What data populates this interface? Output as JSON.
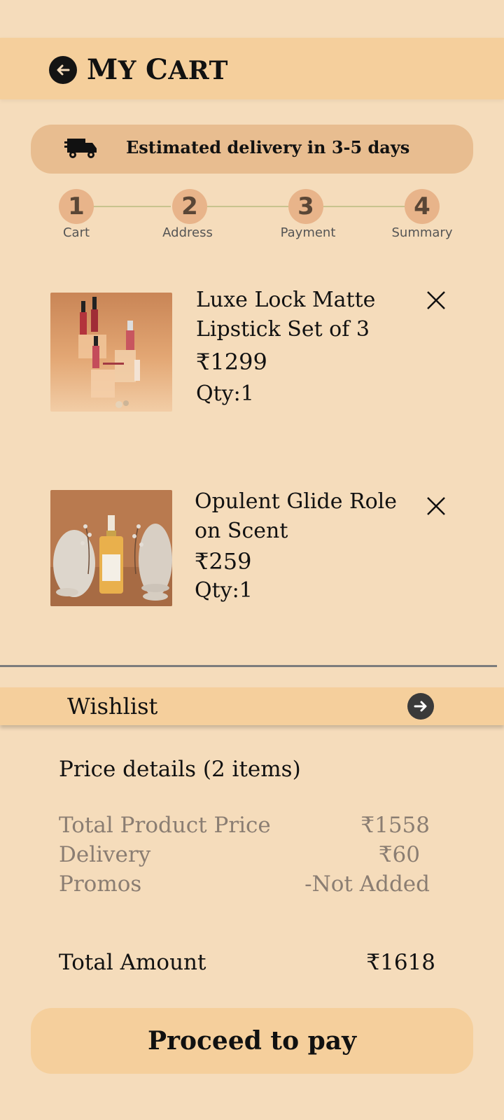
{
  "header": {
    "title_first": "M",
    "title_rest_1": "Y ",
    "title_second": "C",
    "title_rest_2": "ART"
  },
  "banner": {
    "text": "Estimated delivery in 3-5 days"
  },
  "steps": [
    {
      "number": "1",
      "label": "Cart"
    },
    {
      "number": "2",
      "label": "Address"
    },
    {
      "number": "3",
      "label": "Payment"
    },
    {
      "number": "4",
      "label": "Summary"
    }
  ],
  "items": [
    {
      "name": "Luxe Lock Matte Lipstick Set of 3",
      "price": "₹1299",
      "qty": "Qty:1"
    },
    {
      "name": "Opulent Glide Role on Scent",
      "price": "₹259",
      "qty": "Qty:1"
    }
  ],
  "wishlist": {
    "label": "Wishlist"
  },
  "price_details": {
    "title": "Price details (2 items)",
    "rows": [
      {
        "label": "Total Product Price",
        "value": "₹1558"
      },
      {
        "label": "Delivery",
        "value": "₹60"
      },
      {
        "label": "Promos",
        "value": "-Not Added"
      }
    ],
    "total_label": "Total Amount",
    "total_value": "₹1618"
  },
  "cta": {
    "label": "Proceed to pay"
  },
  "colors": {
    "background": "#f5dcbb",
    "header": "#f5cf9c",
    "banner": "#e8bd90",
    "step": "#e8b48a"
  }
}
